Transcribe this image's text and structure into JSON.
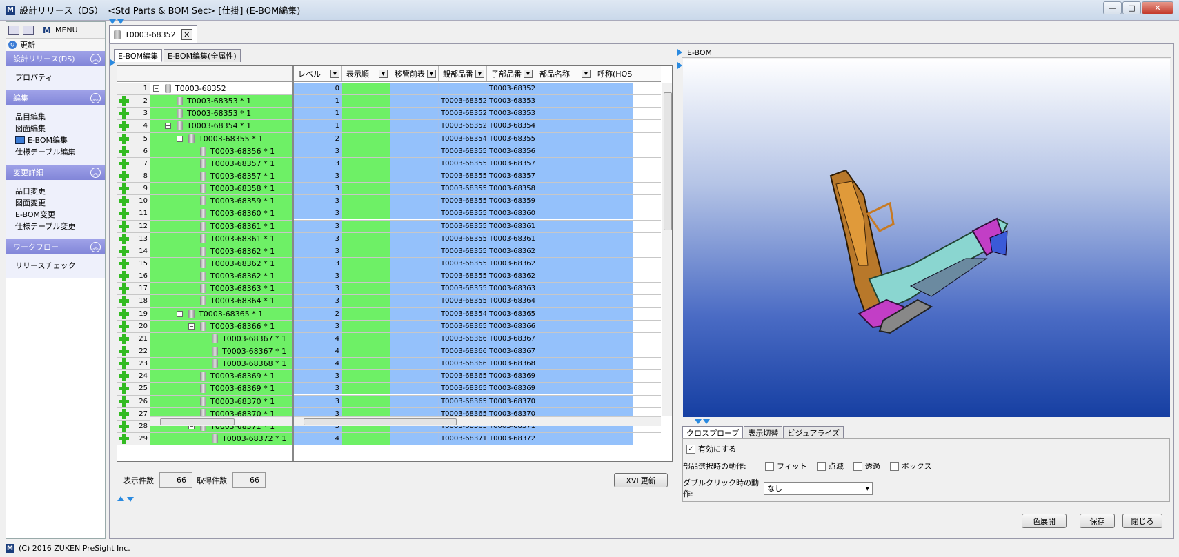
{
  "window": {
    "title": "設計リリース（DS）　<Std Parts & BOM Sec> [仕掛] (E-BOM編集)",
    "icon": "M",
    "min": "—",
    "max": "□",
    "close": "✕"
  },
  "sidebar": {
    "menu_label": "MENU",
    "refresh_label": "更新",
    "sections": [
      {
        "title": "設計リリース(DS)",
        "items": [
          "プロパティ"
        ]
      },
      {
        "title": "編集",
        "items": [
          "品目編集",
          "図面編集",
          "E-BOM編集",
          "仕様テーブル編集"
        ]
      },
      {
        "title": "変更詳細",
        "items": [
          "品目変更",
          "図面変更",
          "E-BOM変更",
          "仕様テーブル変更"
        ]
      },
      {
        "title": "ワークフロー",
        "items": [
          "リリースチェック"
        ]
      }
    ]
  },
  "doc_tab": {
    "label": "T0003-68352",
    "close": "✕"
  },
  "subtabs": [
    "E-BOM編集",
    "E-BOM編集(全属性)"
  ],
  "columns": [
    "レベル",
    "表示順",
    "移管前表",
    "親部品番",
    "子部品番",
    "部品名称",
    "呼称(HOS"
  ],
  "rows": [
    {
      "n": "1",
      "label": "T0003-68352",
      "lv": "0",
      "parent": "",
      "child": "T0003-68352"
    },
    {
      "n": "2",
      "label": "T0003-68353 * 1",
      "lv": "1",
      "parent": "T0003-68352",
      "child": "T0003-68353"
    },
    {
      "n": "3",
      "label": "T0003-68353 * 1",
      "lv": "1",
      "parent": "T0003-68352",
      "child": "T0003-68353"
    },
    {
      "n": "4",
      "label": "T0003-68354 * 1",
      "lv": "1",
      "parent": "T0003-68352",
      "child": "T0003-68354"
    },
    {
      "n": "5",
      "label": "T0003-68355 * 1",
      "lv": "2",
      "parent": "T0003-68354",
      "child": "T0003-68355"
    },
    {
      "n": "6",
      "label": "T0003-68356 * 1",
      "lv": "3",
      "parent": "T0003-68355",
      "child": "T0003-68356"
    },
    {
      "n": "7",
      "label": "T0003-68357 * 1",
      "lv": "3",
      "parent": "T0003-68355",
      "child": "T0003-68357"
    },
    {
      "n": "8",
      "label": "T0003-68357 * 1",
      "lv": "3",
      "parent": "T0003-68355",
      "child": "T0003-68357"
    },
    {
      "n": "9",
      "label": "T0003-68358 * 1",
      "lv": "3",
      "parent": "T0003-68355",
      "child": "T0003-68358"
    },
    {
      "n": "10",
      "label": "T0003-68359 * 1",
      "lv": "3",
      "parent": "T0003-68355",
      "child": "T0003-68359"
    },
    {
      "n": "11",
      "label": "T0003-68360 * 1",
      "lv": "3",
      "parent": "T0003-68355",
      "child": "T0003-68360"
    },
    {
      "n": "12",
      "label": "T0003-68361 * 1",
      "lv": "3",
      "parent": "T0003-68355",
      "child": "T0003-68361"
    },
    {
      "n": "13",
      "label": "T0003-68361 * 1",
      "lv": "3",
      "parent": "T0003-68355",
      "child": "T0003-68361"
    },
    {
      "n": "14",
      "label": "T0003-68362 * 1",
      "lv": "3",
      "parent": "T0003-68355",
      "child": "T0003-68362"
    },
    {
      "n": "15",
      "label": "T0003-68362 * 1",
      "lv": "3",
      "parent": "T0003-68355",
      "child": "T0003-68362"
    },
    {
      "n": "16",
      "label": "T0003-68362 * 1",
      "lv": "3",
      "parent": "T0003-68355",
      "child": "T0003-68362"
    },
    {
      "n": "17",
      "label": "T0003-68363 * 1",
      "lv": "3",
      "parent": "T0003-68355",
      "child": "T0003-68363"
    },
    {
      "n": "18",
      "label": "T0003-68364 * 1",
      "lv": "3",
      "parent": "T0003-68355",
      "child": "T0003-68364"
    },
    {
      "n": "19",
      "label": "T0003-68365 * 1",
      "lv": "2",
      "parent": "T0003-68354",
      "child": "T0003-68365"
    },
    {
      "n": "20",
      "label": "T0003-68366 * 1",
      "lv": "3",
      "parent": "T0003-68365",
      "child": "T0003-68366"
    },
    {
      "n": "21",
      "label": "T0003-68367 * 1",
      "lv": "4",
      "parent": "T0003-68366",
      "child": "T0003-68367"
    },
    {
      "n": "22",
      "label": "T0003-68367 * 1",
      "lv": "4",
      "parent": "T0003-68366",
      "child": "T0003-68367"
    },
    {
      "n": "23",
      "label": "T0003-68368 * 1",
      "lv": "4",
      "parent": "T0003-68366",
      "child": "T0003-68368"
    },
    {
      "n": "24",
      "label": "T0003-68369 * 1",
      "lv": "3",
      "parent": "T0003-68365",
      "child": "T0003-68369"
    },
    {
      "n": "25",
      "label": "T0003-68369 * 1",
      "lv": "3",
      "parent": "T0003-68365",
      "child": "T0003-68369"
    },
    {
      "n": "26",
      "label": "T0003-68370 * 1",
      "lv": "3",
      "parent": "T0003-68365",
      "child": "T0003-68370"
    },
    {
      "n": "27",
      "label": "T0003-68370 * 1",
      "lv": "3",
      "parent": "T0003-68365",
      "child": "T0003-68370"
    },
    {
      "n": "28",
      "label": "T0003-68371 * 1",
      "lv": "3",
      "parent": "T0003-68365",
      "child": "T0003-68371"
    },
    {
      "n": "29",
      "label": "T0003-68372 * 1",
      "lv": "4",
      "parent": "T0003-68371",
      "child": "T0003-68372"
    }
  ],
  "counts": {
    "display_label": "表示件数",
    "display_value": "66",
    "fetched_label": "取得件数",
    "fetched_value": "66"
  },
  "xvl_button": "XVL更新",
  "viewer": {
    "title": "E-BOM"
  },
  "prop_tabs": [
    "クロスプローブ",
    "表示切替",
    "ビジュアライズ"
  ],
  "crossprobe": {
    "enable_label": "有効にする",
    "enable_checked": true,
    "select_label": "部品選択時の動作:",
    "options": [
      "フィット",
      "点滅",
      "透過",
      "ボックス"
    ],
    "dblclick_label": "ダブルクリック時の動作:",
    "dblclick_value": "なし"
  },
  "buttons": {
    "color": "色展開",
    "save": "保存",
    "close": "閉じる"
  },
  "footer": {
    "copyright": "(C) 2016 ZUKEN PreSight Inc."
  },
  "colors": {
    "tree_green": "#6ef066",
    "cell_blue": "#94c1fb",
    "section_header": "#8185d8",
    "plus_green": "#33bb22"
  }
}
